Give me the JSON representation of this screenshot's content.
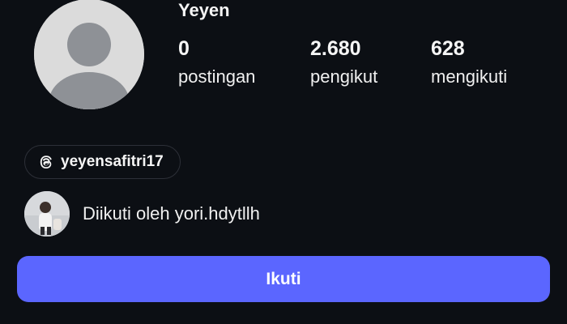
{
  "profile": {
    "username": "Yeyen",
    "avatar_icon": "default-avatar-icon"
  },
  "stats": {
    "posts": {
      "value": "0",
      "label": "postingan"
    },
    "followers": {
      "value": "2.680",
      "label": "pengikut"
    },
    "following": {
      "value": "628",
      "label": "mengikuti"
    }
  },
  "threads": {
    "icon": "threads-icon",
    "handle": "yeyensafitri17"
  },
  "followed_by": {
    "text": "Diikuti oleh yori.hdytllh"
  },
  "actions": {
    "follow_label": "Ikuti"
  },
  "colors": {
    "background": "#0c0f14",
    "accent": "#5b66ff",
    "avatar_placeholder": "#dbdbdb"
  }
}
